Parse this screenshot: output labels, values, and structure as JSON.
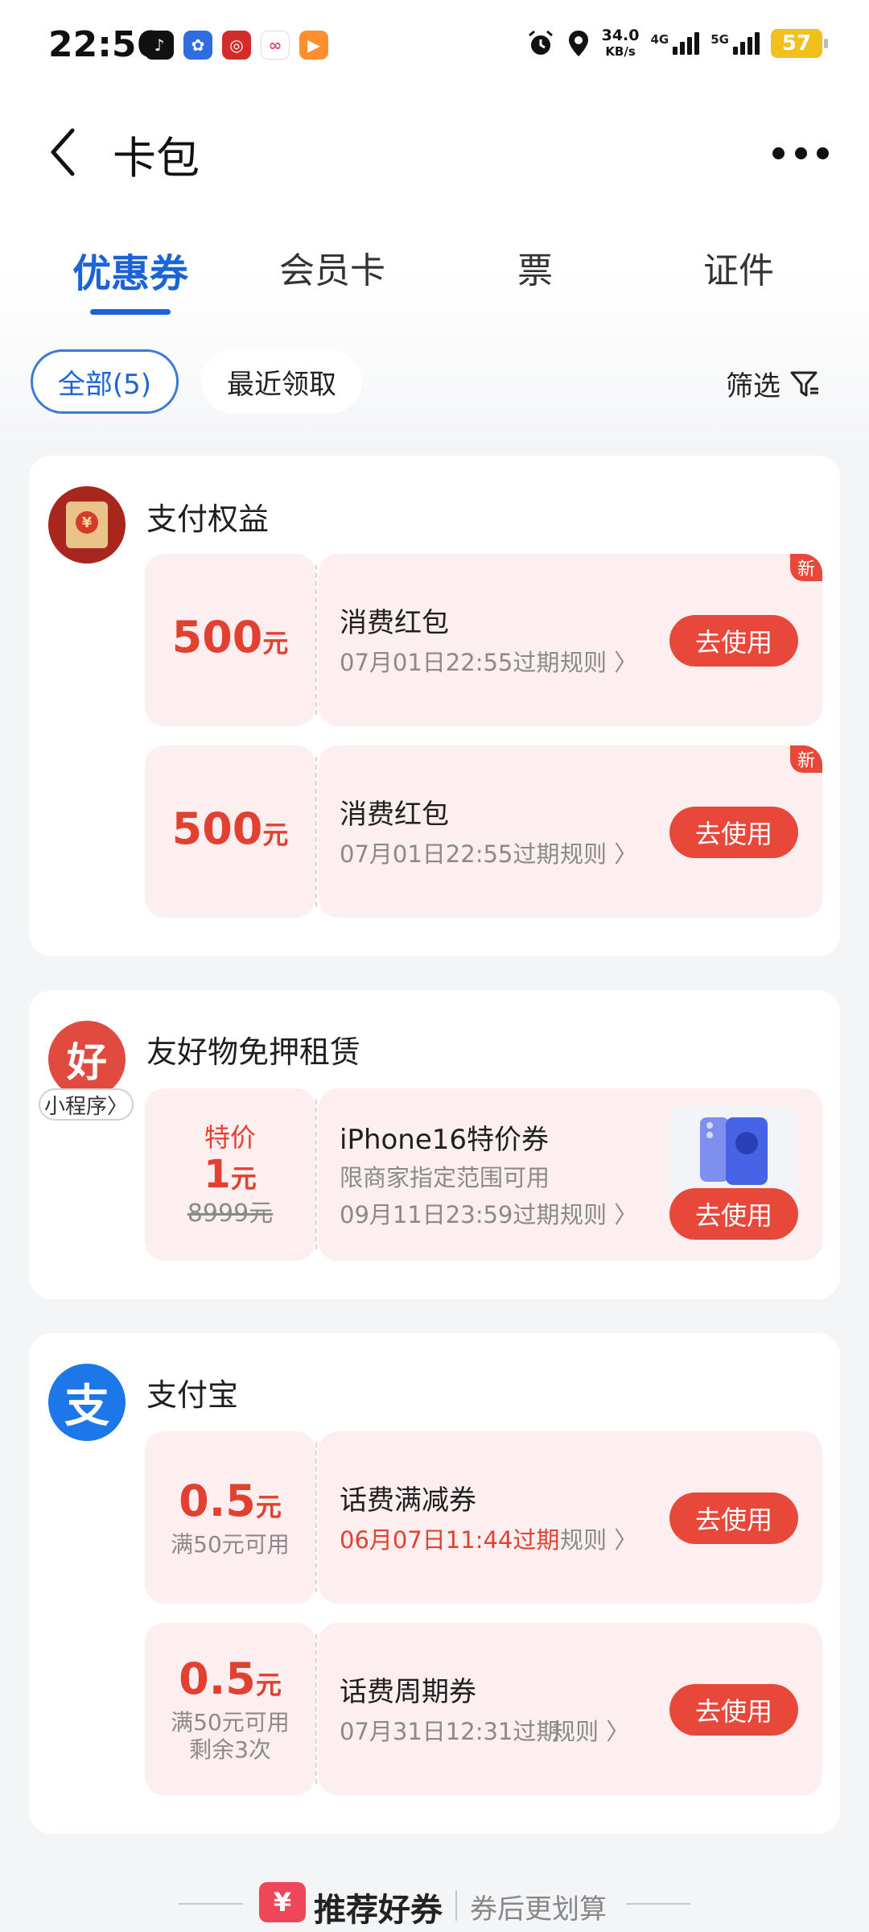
{
  "status_bar": {
    "time": "22:56",
    "speed_value": "34.0",
    "speed_unit": "KB/s",
    "net1": "4G",
    "net2": "5G",
    "battery": "57"
  },
  "header": {
    "title": "卡包"
  },
  "tabs": [
    {
      "label": "优惠券",
      "active": true
    },
    {
      "label": "会员卡",
      "active": false
    },
    {
      "label": "票",
      "active": false
    },
    {
      "label": "证件",
      "active": false
    }
  ],
  "filters": {
    "all": "全部(5)",
    "recent": "最近领取",
    "filter": "筛选"
  },
  "groups": [
    {
      "merchant": "支付权益",
      "coupons": [
        {
          "amount": "500",
          "unit": "元",
          "name": "消费红包",
          "expiry": "07月01日22:55过期",
          "rule": "规则",
          "button": "去使用",
          "badge": "新"
        },
        {
          "amount": "500",
          "unit": "元",
          "name": "消费红包",
          "expiry": "07月01日22:55过期",
          "rule": "规则",
          "button": "去使用",
          "badge": "新"
        }
      ]
    },
    {
      "merchant": "友好物免押租赁",
      "mini_tag": "小程序",
      "logo_char": "好",
      "coupons": [
        {
          "label": "特价",
          "amount": "1",
          "unit": "元",
          "original_price": "8999元",
          "name": "iPhone16特价券",
          "desc": "限商家指定范围可用",
          "expiry": "09月11日23:59过期",
          "rule": "规则",
          "button": "去使用"
        }
      ]
    },
    {
      "merchant": "支付宝",
      "logo_char": "支",
      "coupons": [
        {
          "amount": "0.5",
          "unit": "元",
          "condition": "满50元可用",
          "name": "话费满减券",
          "expiry": "06月07日11:44过期",
          "rule": "规则",
          "button": "去使用"
        },
        {
          "amount": "0.5",
          "unit": "元",
          "condition": "满50元可用",
          "remaining": "剩余3次",
          "name": "话费周期券",
          "expiry": "07月31日12:31过期",
          "rule": "规则",
          "button": "去使用"
        }
      ]
    }
  ],
  "footer": {
    "logo": "¥",
    "title": "推荐好券",
    "subtitle": "券后更划算"
  },
  "colors": {
    "accent_blue": "#1b63d8",
    "coupon_red": "#e24132",
    "button_red": "#e8483a",
    "coupon_bg": "#fdeef0"
  }
}
